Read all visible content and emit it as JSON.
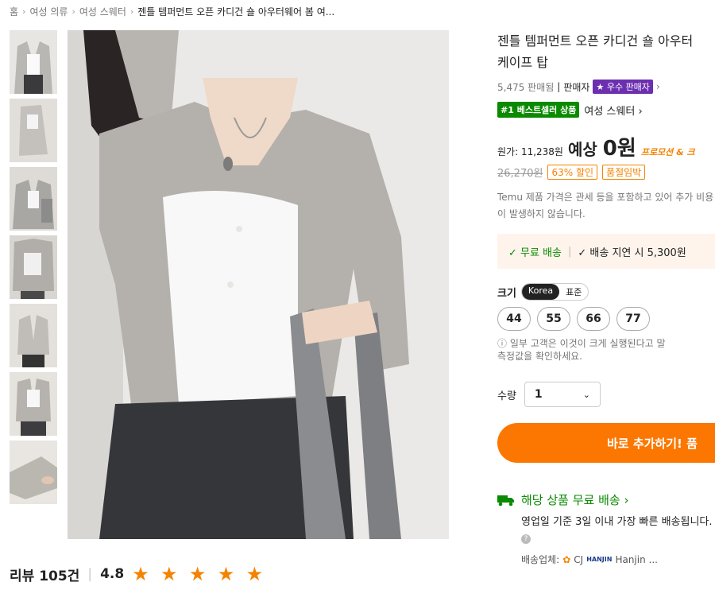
{
  "breadcrumb": [
    "홈",
    "여성 의류",
    "여성 스웨터",
    "젠틀 템퍼먼트 오픈 카디건 숄 아우터웨어 봄 여..."
  ],
  "title": [
    "젠틀 템퍼먼트 오픈 카디건 숄 아우터",
    "케이프 탑"
  ],
  "seller": {
    "sold": "5,475 판매됨",
    "divider": "|",
    "label": "판매자",
    "badge": "우수 판매자",
    "chevron": "›"
  },
  "bestseller": {
    "badge": "#1 베스트셀러 상품",
    "category": "여성 스웨터 ›"
  },
  "price": {
    "original_label": "원가: 11,238원",
    "estimate": "예상",
    "estimate_value": "0원",
    "promo": "프로모션 & 크",
    "strike": "26,270원",
    "discount": "63% 할인",
    "soldout": "품절임박"
  },
  "note": "Temu 제품 가격은 관세 등을 포함하고 있어 추가 비용이 발생하지 않습니다.",
  "shipping_box": {
    "free": "✓ 무료 배송",
    "sep": "|",
    "delay": "✓ 배송 지연 시 5,300원"
  },
  "size": {
    "label": "크기",
    "units": [
      "Korea",
      "표준"
    ],
    "options": [
      "44",
      "55",
      "66",
      "77"
    ],
    "note": [
      "ⓘ 일부 고객은 이것이 크게 실행된다고 말",
      "측정값을 확인하세요."
    ]
  },
  "quantity": {
    "label": "수량",
    "value": "1",
    "chevron": "⌄"
  },
  "cta": "바로 추가하기! 품",
  "free_shipping": {
    "title": "해당 상품 무료 배송 ›",
    "detail": "영업일 기준 3일 이내 가장 빠른 배송됩니다.",
    "carrier_label": "배송업체:",
    "carriers": [
      "CJ",
      "HANJIN",
      "Hanjin ..."
    ]
  },
  "reviews": {
    "label": "리뷰 105건",
    "sep": "|",
    "rating": "4.8",
    "stars": "★ ★ ★ ★ ★"
  },
  "colors": {
    "accent": "#fb7701",
    "green": "#0a8a00",
    "purple": "#6b2fb0"
  }
}
